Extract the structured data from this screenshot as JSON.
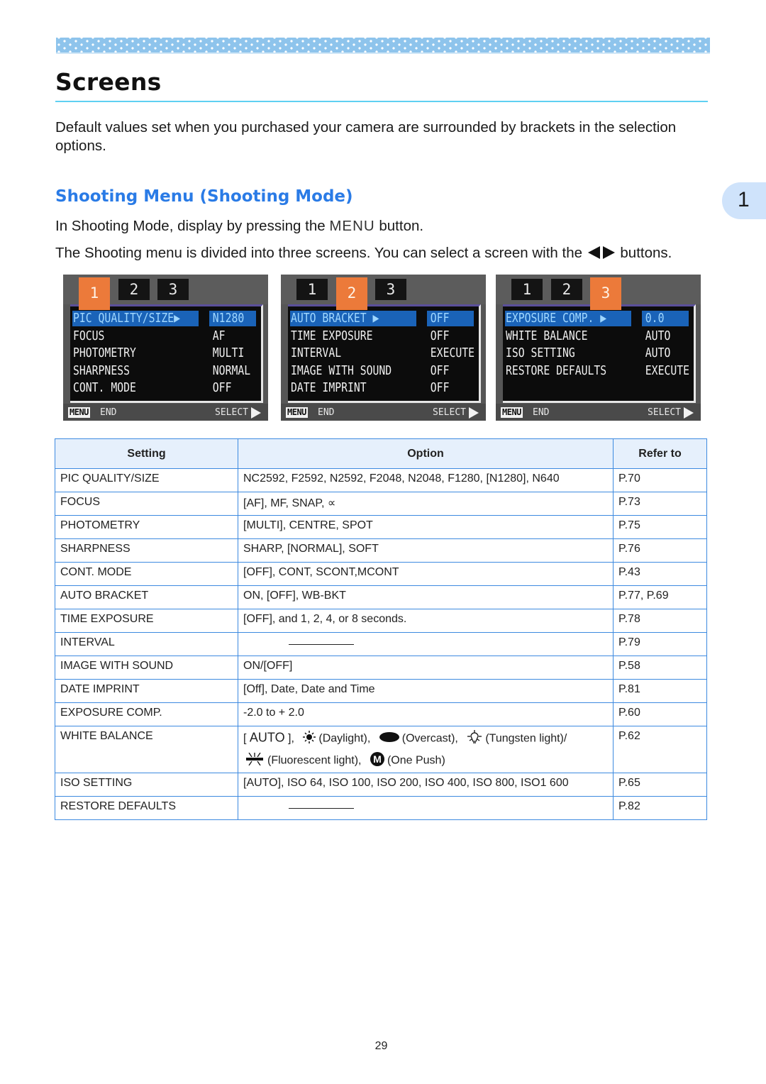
{
  "page": {
    "title": "Screens",
    "intro": "Default values set when you purchased your camera are surrounded by brackets in the selection options.",
    "chapter_tab": "1",
    "page_number": "29"
  },
  "section": {
    "heading": "Shooting Menu (Shooting Mode)",
    "para1_before": "In Shooting Mode, display by pressing the ",
    "para1_menu": "MENU",
    "para1_after": " button.",
    "para2_before": "The Shooting menu is divided into three screens. You can select a screen with the ",
    "para2_icon": "left-right-arrow-buttons-icon",
    "para2_after": " buttons."
  },
  "camera_screens": [
    {
      "tabs": [
        "1",
        "2",
        "3"
      ],
      "active_tab": 0,
      "rows": [
        {
          "label": "PIC QUALITY/SIZE▶",
          "value": "N1280",
          "selected": true
        },
        {
          "label": "FOCUS",
          "value": "AF"
        },
        {
          "label": "PHOTOMETRY",
          "value": "MULTI"
        },
        {
          "label": "SHARPNESS",
          "value": "NORMAL"
        },
        {
          "label": "CONT. MODE",
          "value": "OFF"
        }
      ],
      "footer": {
        "menu_key": "MENU",
        "end": "END",
        "select": "SELECT"
      }
    },
    {
      "tabs": [
        "1",
        "2",
        "3"
      ],
      "active_tab": 1,
      "rows": [
        {
          "label": "AUTO BRACKET    ▶",
          "value": "OFF",
          "selected": true
        },
        {
          "label": "TIME EXPOSURE",
          "value": "OFF"
        },
        {
          "label": "INTERVAL",
          "value": "EXECUTE"
        },
        {
          "label": "IMAGE WITH SOUND",
          "value": "OFF"
        },
        {
          "label": "DATE IMPRINT",
          "value": "OFF"
        }
      ],
      "footer": {
        "menu_key": "MENU",
        "end": "END",
        "select": "SELECT"
      }
    },
    {
      "tabs": [
        "1",
        "2",
        "3"
      ],
      "active_tab": 2,
      "rows": [
        {
          "label": "EXPOSURE COMP.  ▶",
          "value": "0.0",
          "selected": true
        },
        {
          "label": "WHITE BALANCE",
          "value": "AUTO"
        },
        {
          "label": "ISO SETTING",
          "value": "AUTO"
        },
        {
          "label": "RESTORE DEFAULTS",
          "value": "EXECUTE"
        }
      ],
      "footer": {
        "menu_key": "MENU",
        "end": "END",
        "select": "SELECT"
      }
    }
  ],
  "table": {
    "headers": [
      "Setting",
      "Option",
      "Refer to"
    ],
    "rows": [
      {
        "setting": "PIC QUALITY/SIZE",
        "option": "NC2592, F2592, N2592, F2048, N2048, F1280, [N1280], N640",
        "refer": "P.70"
      },
      {
        "setting": "FOCUS",
        "option": "[AF], MF, SNAP, ∝",
        "refer": "P.73"
      },
      {
        "setting": "PHOTOMETRY",
        "option": "[MULTI], CENTRE, SPOT",
        "refer": "P.75"
      },
      {
        "setting": "SHARPNESS",
        "option": "SHARP, [NORMAL], SOFT",
        "refer": "P.76"
      },
      {
        "setting": "CONT. MODE",
        "option": "[OFF], CONT, SCONT,MCONT",
        "refer": "P.43"
      },
      {
        "setting": "AUTO BRACKET",
        "option": "ON, [OFF], WB-BKT",
        "refer": "P.77, P.69"
      },
      {
        "setting": "TIME EXPOSURE",
        "option": "[OFF], and  1, 2, 4, or 8 seconds.",
        "refer": "P.78"
      },
      {
        "setting": "INTERVAL",
        "option": "",
        "option_dash": true,
        "refer": "P.79"
      },
      {
        "setting": "IMAGE WITH SOUND",
        "option": "ON/[OFF]",
        "refer": "P.58"
      },
      {
        "setting": "DATE IMPRINT",
        "option": "[Off], Date, Date and Time",
        "refer": "P.81"
      },
      {
        "setting": "EXPOSURE COMP.",
        "option": "-2.0 to + 2.0",
        "refer": "P.60"
      },
      {
        "setting": "WHITE BALANCE",
        "option": "",
        "refer": "P.62",
        "wb_options": {
          "auto_open": "[ ",
          "auto": "AUTO",
          "auto_close": " ],",
          "daylight": "(Daylight),",
          "daylight_icon": "sun-icon",
          "overcast": "(Overcast),",
          "overcast_icon": "cloud-icon",
          "tungsten": "(Tungsten light)/",
          "tungsten_icon": "light-bulb-icon",
          "fluorescent": "(Fluorescent light),",
          "fluorescent_icon": "fluorescent-tube-icon",
          "one_push": "(One Push)",
          "one_push_icon": "m-circle-icon"
        }
      },
      {
        "setting": "ISO SETTING",
        "option": "[AUTO], ISO 64, ISO 100, ISO 200, ISO 400, ISO 800, ISO1 600",
        "refer": "P.65"
      },
      {
        "setting": "RESTORE DEFAULTS",
        "option": "",
        "option_dash": true,
        "refer": "P.82"
      }
    ]
  },
  "colors": {
    "heading_blue": "#2a7be6",
    "rule_cyan": "#5fd0f2",
    "table_border": "#3d8ae0",
    "table_header_bg": "#e6f0fc",
    "chapter_tab_bg": "#cfe3fb",
    "camera_active_tab": "#ec7a3a",
    "camera_highlight": "#1a63b8"
  }
}
